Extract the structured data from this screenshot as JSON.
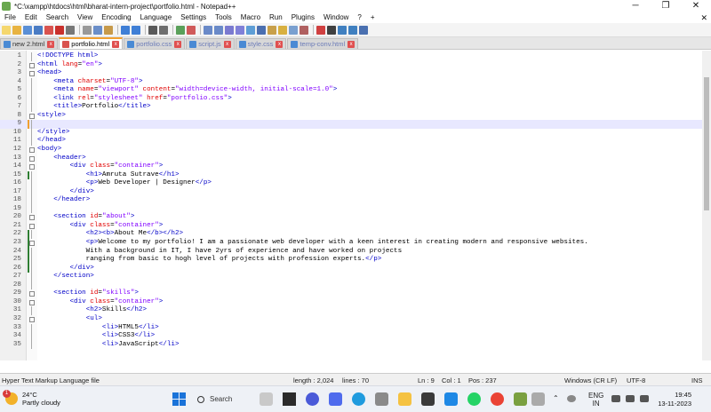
{
  "window": {
    "title": "*C:\\xampp\\htdocs\\html\\bharat-intern-project\\portfolio.html - Notepad++",
    "min": "─",
    "max": "❐",
    "close": "✕"
  },
  "menu": {
    "items": [
      "File",
      "Edit",
      "Search",
      "View",
      "Encoding",
      "Language",
      "Settings",
      "Tools",
      "Macro",
      "Run",
      "Plugins",
      "Window",
      "?"
    ],
    "plus": "+",
    "close": "✕"
  },
  "tabs": [
    {
      "label": "new 2.html",
      "active": false,
      "dim": false
    },
    {
      "label": "portfolio.html",
      "active": true,
      "dim": false
    },
    {
      "label": "portfolio.css",
      "active": false,
      "dim": true
    },
    {
      "label": "script.js",
      "active": false,
      "dim": true
    },
    {
      "label": "style.css",
      "active": false,
      "dim": true
    },
    {
      "label": "temp-conv.html",
      "active": false,
      "dim": true
    }
  ],
  "tab_close": "x",
  "editor": {
    "lines": [
      {
        "n": "1",
        "html": "<span class=\"tg\">&lt;!DOCTYPE html&gt;</span>"
      },
      {
        "n": "2",
        "html": "<span class=\"tg\">&lt;html</span> <span class=\"at\">lang</span>=<span class=\"av\">\"en\"</span><span class=\"tg\">&gt;</span>"
      },
      {
        "n": "3",
        "html": "<span class=\"tg\">&lt;head&gt;</span>"
      },
      {
        "n": "4",
        "html": "    <span class=\"tg\">&lt;meta</span> <span class=\"at\">charset</span>=<span class=\"av\">\"UTF-8\"</span><span class=\"tg\">&gt;</span>"
      },
      {
        "n": "5",
        "html": "    <span class=\"tg\">&lt;meta</span> <span class=\"at\">name</span>=<span class=\"av\">\"viewport\"</span> <span class=\"at\">content</span>=<span class=\"av\">\"width=device-width, initial-scale=1.0\"</span><span class=\"tg\">&gt;</span>"
      },
      {
        "n": "6",
        "html": "    <span class=\"tg\">&lt;link</span> <span class=\"at\">rel</span>=<span class=\"av\">\"stylesheet\"</span> <span class=\"at\">href</span>=<span class=\"av\">\"portfolio.css\"</span><span class=\"tg\">&gt;</span>"
      },
      {
        "n": "7",
        "html": "    <span class=\"tg\">&lt;title&gt;</span>Portfolio<span class=\"tg\">&lt;/title&gt;</span>"
      },
      {
        "n": "8",
        "html": "<span class=\"tg\">&lt;style&gt;</span>"
      },
      {
        "n": "9",
        "html": "",
        "cur": true
      },
      {
        "n": "10",
        "html": "<span class=\"tg\">&lt;/style&gt;</span>"
      },
      {
        "n": "11",
        "html": "<span class=\"tg\">&lt;/head&gt;</span>"
      },
      {
        "n": "12",
        "html": "<span class=\"tg\">&lt;body&gt;</span>"
      },
      {
        "n": "13",
        "html": "    <span class=\"tg\">&lt;header&gt;</span>"
      },
      {
        "n": "14",
        "html": "        <span class=\"tg\">&lt;div</span> <span class=\"at\">class</span>=<span class=\"av\">\"container\"</span><span class=\"tg\">&gt;</span>"
      },
      {
        "n": "15",
        "html": "            <span class=\"tg\">&lt;h1&gt;</span>Amruta Sutrave<span class=\"tg\">&lt;/h1&gt;</span>"
      },
      {
        "n": "16",
        "html": "            <span class=\"tg\">&lt;p&gt;</span>Web Developer | Designer<span class=\"tg\">&lt;/p&gt;</span>"
      },
      {
        "n": "17",
        "html": "        <span class=\"tg\">&lt;/div&gt;</span>"
      },
      {
        "n": "18",
        "html": "    <span class=\"tg\">&lt;/header&gt;</span>"
      },
      {
        "n": "19",
        "html": ""
      },
      {
        "n": "20",
        "html": "    <span class=\"tg\">&lt;section</span> <span class=\"at\">id</span>=<span class=\"av\">\"about\"</span><span class=\"tg\">&gt;</span>"
      },
      {
        "n": "21",
        "html": "        <span class=\"tg\">&lt;div</span> <span class=\"at\">class</span>=<span class=\"av\">\"container\"</span><span class=\"tg\">&gt;</span>"
      },
      {
        "n": "22",
        "html": "            <span class=\"tg\">&lt;h2&gt;&lt;b&gt;</span>About Me<span class=\"tg\">&lt;/b&gt;&lt;/h2&gt;</span>"
      },
      {
        "n": "23",
        "html": "            <span class=\"tg\">&lt;p&gt;</span>Welcome to my portfolio! I am a passionate web developer with a keen interest in creating modern and responsive websites."
      },
      {
        "n": "24",
        "html": "            With a background in IT, I have 2yrs of experience and have worked on projects"
      },
      {
        "n": "25",
        "html": "            ranging from basic to hogh level of projects with profession experts.<span class=\"tg\">&lt;/p&gt;</span>"
      },
      {
        "n": "26",
        "html": "        <span class=\"tg\">&lt;/div&gt;</span>"
      },
      {
        "n": "27",
        "html": "    <span class=\"tg\">&lt;/section&gt;</span>"
      },
      {
        "n": "28",
        "html": ""
      },
      {
        "n": "29",
        "html": "    <span class=\"tg\">&lt;section</span> <span class=\"at\">id</span>=<span class=\"av\">\"skills\"</span><span class=\"tg\">&gt;</span>"
      },
      {
        "n": "30",
        "html": "        <span class=\"tg\">&lt;div</span> <span class=\"at\">class</span>=<span class=\"av\">\"container\"</span><span class=\"tg\">&gt;</span>"
      },
      {
        "n": "31",
        "html": "            <span class=\"tg\">&lt;h2&gt;</span>Skills<span class=\"tg\">&lt;/h2&gt;</span>"
      },
      {
        "n": "32",
        "html": "            <span class=\"tg\">&lt;ul&gt;</span>"
      },
      {
        "n": "33",
        "html": "                <span class=\"tg\">&lt;li&gt;</span>HTML5<span class=\"tg\">&lt;/li&gt;</span>"
      },
      {
        "n": "34",
        "html": "                <span class=\"tg\">&lt;li&gt;</span>CSS3<span class=\"tg\">&lt;/li&gt;</span>"
      },
      {
        "n": "35",
        "html": "                <span class=\"tg\">&lt;li&gt;</span>JavaScript<span class=\"tg\">&lt;/li&gt;</span>"
      }
    ]
  },
  "status": {
    "lang": "Hyper Text Markup Language file",
    "length": "length : 2,024",
    "lines": "lines : 70",
    "ln": "Ln : 9",
    "col": "Col : 1",
    "pos": "Pos : 237",
    "eol": "Windows (CR LF)",
    "enc": "UTF-8",
    "ins": "INS"
  },
  "taskbar": {
    "weather_badge": "1",
    "temp": "24°C",
    "weather": "Partly cloudy",
    "search": "Search",
    "tray_up": "⌃",
    "lang_top": "ENG",
    "lang_bottom": "IN",
    "time": "19:45",
    "date": "13-11-2023"
  }
}
